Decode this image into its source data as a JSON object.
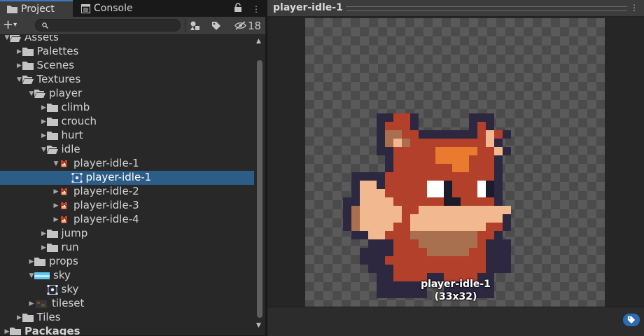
{
  "tabs": {
    "project": "Project",
    "console": "Console",
    "lock_icon": "lock-icon",
    "menu_icon": "kebab-menu-icon"
  },
  "toolbar": {
    "add_icon": "plus-icon",
    "search_placeholder": "",
    "filter_by_type_icon": "shapes-icon",
    "filter_by_label_icon": "tag-icon",
    "hidden_count": "18"
  },
  "tree": [
    {
      "depth": 0,
      "label": "Assets",
      "icon": "folder-open-icon",
      "expanded": true,
      "clipped": true
    },
    {
      "depth": 1,
      "label": "Palettes",
      "icon": "folder-icon",
      "expanded": false
    },
    {
      "depth": 1,
      "label": "Scenes",
      "icon": "folder-icon",
      "expanded": false
    },
    {
      "depth": 1,
      "label": "Textures",
      "icon": "folder-open-icon",
      "expanded": true
    },
    {
      "depth": 2,
      "label": "player",
      "icon": "folder-open-icon",
      "expanded": true
    },
    {
      "depth": 3,
      "label": "climb",
      "icon": "folder-icon",
      "expanded": false
    },
    {
      "depth": 3,
      "label": "crouch",
      "icon": "folder-icon",
      "expanded": false
    },
    {
      "depth": 3,
      "label": "hurt",
      "icon": "folder-icon",
      "expanded": false
    },
    {
      "depth": 3,
      "label": "idle",
      "icon": "folder-open-icon",
      "expanded": true
    },
    {
      "depth": 4,
      "label": "player-idle-1",
      "icon": "fox-texture-icon",
      "expanded": true
    },
    {
      "depth": 5,
      "label": "player-idle-1",
      "icon": "sprite-icon",
      "selected": true
    },
    {
      "depth": 4,
      "label": "player-idle-2",
      "icon": "fox-texture-icon",
      "expanded": false
    },
    {
      "depth": 4,
      "label": "player-idle-3",
      "icon": "fox-texture-icon",
      "expanded": false
    },
    {
      "depth": 4,
      "label": "player-idle-4",
      "icon": "fox-texture-icon",
      "expanded": false
    },
    {
      "depth": 3,
      "label": "jump",
      "icon": "folder-icon",
      "expanded": false
    },
    {
      "depth": 3,
      "label": "run",
      "icon": "folder-icon",
      "expanded": false
    },
    {
      "depth": 2,
      "label": "props",
      "icon": "folder-icon",
      "expanded": false
    },
    {
      "depth": 2,
      "label": "sky",
      "icon": "sky-texture-icon",
      "expanded": true
    },
    {
      "depth": 3,
      "label": "sky",
      "icon": "sprite-icon"
    },
    {
      "depth": 2,
      "label": "tileset",
      "icon": "tileset-texture-icon",
      "expanded": false
    },
    {
      "depth": 1,
      "label": "Tiles",
      "icon": "folder-icon",
      "expanded": false
    },
    {
      "depth": 0,
      "label": "Packages",
      "icon": "folder-icon",
      "expanded": false,
      "bold": true
    }
  ],
  "preview": {
    "title": "player-idle-1",
    "caption_name": "player-idle-1",
    "caption_size": "(33x32)",
    "tag_icon": "tag-icon"
  },
  "colors": {
    "selection": "#2c5d87",
    "accent": "#3a79bb",
    "folder": "#c4c4c4"
  }
}
